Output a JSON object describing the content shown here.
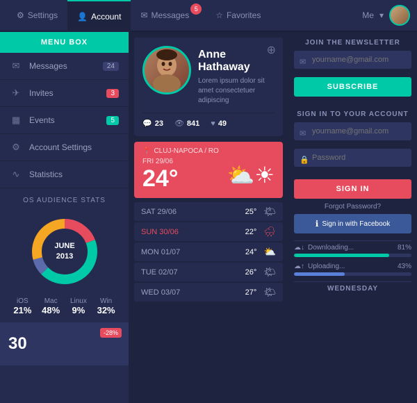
{
  "nav": {
    "tabs": [
      {
        "id": "settings",
        "label": "Settings",
        "icon": "⚙",
        "active": false,
        "badge": null
      },
      {
        "id": "account",
        "label": "Account",
        "icon": "👤",
        "active": true,
        "badge": null
      },
      {
        "id": "messages",
        "label": "Messages",
        "icon": "✉",
        "active": false,
        "badge": "5"
      },
      {
        "id": "favorites",
        "label": "Favorites",
        "icon": "☆",
        "active": false,
        "badge": null
      }
    ],
    "user_label": "Me",
    "chevron": "▾"
  },
  "sidebar": {
    "menu_box_title": "MENU BOX",
    "items": [
      {
        "label": "Messages",
        "icon": "✉",
        "badge": "24",
        "badge_type": "normal"
      },
      {
        "label": "Invites",
        "icon": "✈",
        "badge": "3",
        "badge_type": "red"
      },
      {
        "label": "Events",
        "icon": "📅",
        "badge": "5",
        "badge_type": "teal"
      },
      {
        "label": "Account Settings",
        "icon": "⚙",
        "badge": null,
        "badge_type": null
      },
      {
        "label": "Statistics",
        "icon": "〜",
        "badge": null,
        "badge_type": null
      }
    ],
    "stats_title": "OS AUDIENCE STATS",
    "donut": {
      "center_text": "JUNE",
      "center_year": "2013",
      "segments": [
        {
          "label": "iOS",
          "pct": "21%",
          "color": "#e74c5e",
          "value": 21
        },
        {
          "label": "Mac",
          "pct": "48%",
          "color": "#00c9a7",
          "value": 48
        },
        {
          "label": "Linux",
          "pct": "9%",
          "color": "#5b6bab",
          "value": 9
        },
        {
          "label": "Win",
          "pct": "32%",
          "color": "#f5a623",
          "value": 32
        }
      ]
    },
    "bottom_number": "30",
    "bottom_badge": "-28%"
  },
  "profile": {
    "name": "Anne Hathaway",
    "description": "Lorem ipsum dolor sit amet consectetuer adipiscing",
    "stats": [
      {
        "icon": "💬",
        "value": "23"
      },
      {
        "icon": "👁",
        "value": "841"
      },
      {
        "icon": "♥",
        "value": "49"
      }
    ]
  },
  "weather": {
    "location": "CLUJ-NAPOCA / RO",
    "main_date": "FRI 29/06",
    "main_temp": "24°",
    "rows": [
      {
        "day": "SAT 29/06",
        "temp": "25°",
        "icon": "🌤",
        "sunday": false
      },
      {
        "day": "SUN 30/06",
        "temp": "22°",
        "icon": "🌧",
        "sunday": true
      },
      {
        "day": "MON 01/07",
        "temp": "24°",
        "icon": "⛅",
        "sunday": false
      },
      {
        "day": "TUE 02/07",
        "temp": "26°",
        "icon": "🌤",
        "sunday": false
      },
      {
        "day": "WED 03/07",
        "temp": "27°",
        "icon": "🌤",
        "sunday": false
      }
    ]
  },
  "newsletter": {
    "title": "JOIN THE NEWSLETTER",
    "placeholder": "yourname@gmail.com",
    "button_label": "SUBSCRIBE"
  },
  "signin": {
    "title": "SIGN IN TO YOUR ACCOUNT",
    "email_placeholder": "yourname@gmail.com",
    "password_placeholder": "Password",
    "button_label": "SIGN IN",
    "forgot_label": "Forgot Password?",
    "facebook_label": "Sign in with Facebook"
  },
  "progress": [
    {
      "label": "Downloading...",
      "pct": 81,
      "color": "#00c9a7"
    },
    {
      "label": "Uploading...",
      "pct": 43,
      "color": "#5b80d9"
    }
  ],
  "wednesday": {
    "title": "WEDNESDAY"
  }
}
